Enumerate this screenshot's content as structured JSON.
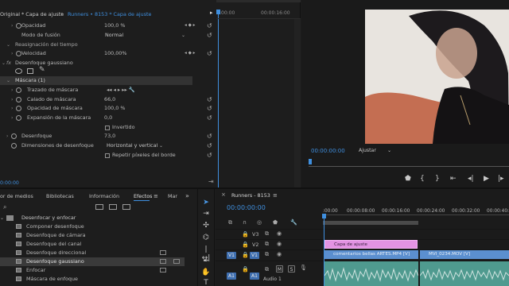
{
  "effect_controls": {
    "tab_label": "Original * Capa de ajuste",
    "sequence_clip": "Runners • 8153 * Capa de ajuste",
    "timecode_start": ":00:00",
    "timecode_mark": "00:00:16:00",
    "rows": [
      {
        "label": "Opacidad",
        "value": "100,0 %"
      },
      {
        "label": "Modo de fusión",
        "value": "Normal"
      },
      {
        "label": "Reasignación del tiempo",
        "value": ""
      },
      {
        "label": "Velocidad",
        "value": "100,00%"
      },
      {
        "label": "Desenfoque gaussiano",
        "value": ""
      },
      {
        "label": "Máscara (1)",
        "value": ""
      },
      {
        "label": "Trazado de máscara",
        "value": ""
      },
      {
        "label": "Calado de máscara",
        "value": "66,0"
      },
      {
        "label": "Opacidad de máscara",
        "value": "100,0 %"
      },
      {
        "label": "Expansión de la máscara",
        "value": "0,0"
      },
      {
        "label": "Invertido",
        "value": ""
      },
      {
        "label": "Desenfoque",
        "value": "73,0"
      },
      {
        "label": "Dimensiones de desenfoque",
        "value": "Horizontal y vertical"
      },
      {
        "label": "Repetir píxeles del borde",
        "value": ""
      }
    ],
    "footer_timecode": "0:00:00"
  },
  "program": {
    "timecode": "00:00:00:00",
    "fit": "Ajustar"
  },
  "project_panel": {
    "tabs": [
      "or de medios",
      "Bibliotecas",
      "Información",
      "Efectos",
      "Mar"
    ],
    "folder": "Desenfocar y enfocar",
    "items": [
      "Componer desenfoque",
      "Desenfoque de cámara",
      "Desenfoque del canal",
      "Desenfoque direccional",
      "Desenfoque gaussiano",
      "Enfocar",
      "Máscara de enfoque"
    ]
  },
  "timeline": {
    "tab": "Runners - 8153",
    "timecode": "00:00:00:00",
    "ruler": [
      ":00:00",
      "00:00:08:00",
      "00:00:16:00",
      "00:00:24:00",
      "00:00:32:00",
      "00:00:40:"
    ],
    "tracks": [
      {
        "name": "V3",
        "src": ""
      },
      {
        "name": "V2",
        "src": "V1"
      },
      {
        "name": "V1",
        "src": "V1"
      },
      {
        "name": "A1",
        "src": "A1"
      }
    ],
    "clips": {
      "adjustment": "Capa de ajuste",
      "v1_a": "comentarios bellas ARTES.MP4 [V]",
      "v1_b": "MVI_0234.MOV [V]"
    },
    "audio_label": "Audio 1",
    "track_buttons": [
      "M",
      "S"
    ]
  },
  "colors": {
    "accent": "#3f8fdf",
    "adjustment_clip": "#e393e3",
    "video_clip": "#5b8fcf",
    "audio_clip": "#4f9a8f"
  }
}
